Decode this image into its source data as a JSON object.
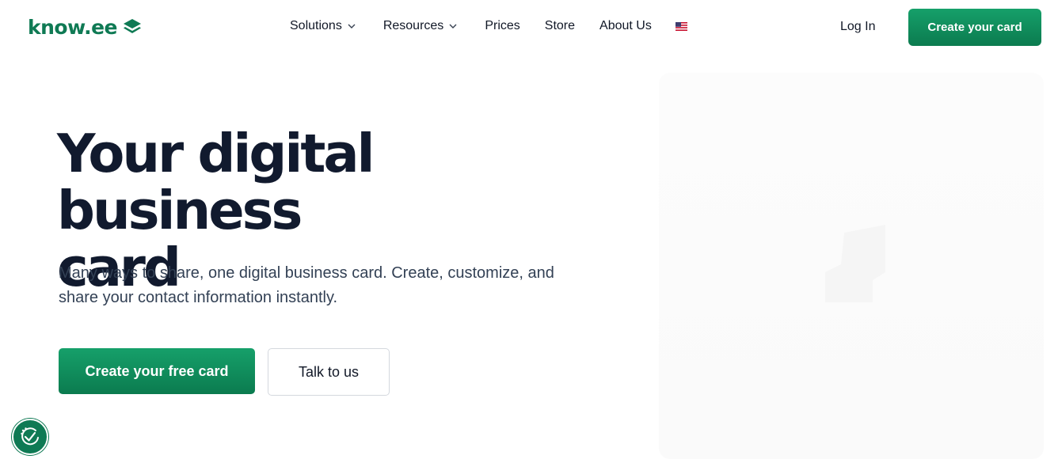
{
  "brand": {
    "name": "know.ee",
    "color": "#0f7a54",
    "icon": "stacked-layers-icon"
  },
  "nav": {
    "items": [
      {
        "label": "Solutions",
        "has_dropdown": true
      },
      {
        "label": "Resources",
        "has_dropdown": true
      },
      {
        "label": "Prices",
        "has_dropdown": false
      },
      {
        "label": "Store",
        "has_dropdown": false
      },
      {
        "label": "About Us",
        "has_dropdown": false
      }
    ],
    "language_icon": "us-flag-icon"
  },
  "header": {
    "login_label": "Log In",
    "cta_label": "Create your card"
  },
  "hero": {
    "title_line1": "Your digital business",
    "title_line2": "card",
    "subtitle_line1": "Many ways to share, one digital business card. Create, customize, and",
    "subtitle_line2": "share your contact information instantly.",
    "primary_button": "Create your free card",
    "secondary_button": "Talk to us"
  },
  "floating_badge": {
    "icon": "accessibility-check-icon"
  },
  "colors": {
    "accent": "#0f7a54",
    "text_dark": "#111a2e",
    "text_body": "#334155"
  }
}
